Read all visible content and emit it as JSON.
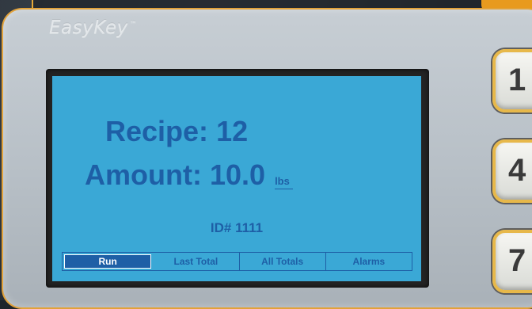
{
  "brand": {
    "name": "EasyKey",
    "trademark": "™"
  },
  "screen": {
    "recipe_label": "Recipe:",
    "recipe_value": "12",
    "amount_label": "Amount:",
    "amount_value": "10.0",
    "amount_unit": "lbs",
    "id_text": "ID# 1111",
    "softkeys": [
      {
        "label": "Run",
        "active": true
      },
      {
        "label": "Last Total",
        "active": false
      },
      {
        "label": "All Totals",
        "active": false
      },
      {
        "label": "Alarms",
        "active": false
      }
    ]
  },
  "keypad": {
    "keys": [
      "1",
      "4",
      "7"
    ]
  },
  "colors": {
    "screen_bg": "#3aa8d6",
    "screen_text": "#1e5fa6",
    "panel_border": "#e2a23a"
  }
}
